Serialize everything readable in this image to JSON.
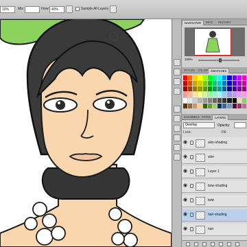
{
  "options_bar": {
    "zoom_field": "10%",
    "mix_label": "Mix:",
    "flow_label": "Flow:",
    "flow_value": "40%",
    "sample_all_layers": "Sample All Layers"
  },
  "navigator": {
    "tabs": [
      "NAVIGATOR",
      "INFO",
      "HISTORY"
    ],
    "active_tab": "NAVIGATOR",
    "zoom": "100%"
  },
  "swatches": {
    "tabs": [
      "STYLES",
      "COLOR",
      "SWATCHES"
    ],
    "active_tab": "SWATCHES"
  },
  "layers": {
    "tabs": [
      "CHANNELS",
      "PATHS",
      "LAYERS"
    ],
    "active_tab": "LAYERS",
    "blend_mode": "Overlay",
    "opacity_label": "Opacity:",
    "lock_label": "Lock:",
    "fill_label": "Fill:",
    "items": [
      {
        "name": "skin-shading"
      },
      {
        "name": "skin"
      },
      {
        "name": "Layer 1"
      },
      {
        "name": "bow-shading"
      },
      {
        "name": "bow"
      },
      {
        "name": "hair-shading"
      },
      {
        "name": "hair"
      }
    ],
    "selected_layer": "hair-shading"
  },
  "colors": {
    "panel_bg": "#d0d0d0",
    "selected_layer": "#b9d1ec",
    "bow_green": "#8bd35d",
    "hair": "#2b2b2b",
    "skin": "#f9d6ad"
  }
}
